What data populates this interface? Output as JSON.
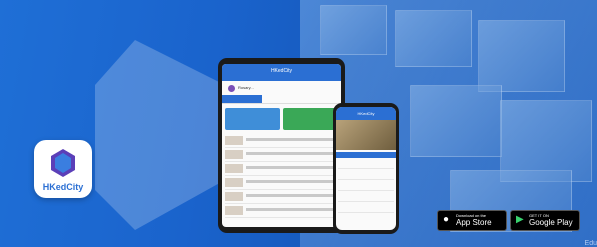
{
  "app": {
    "name": "HKedCity",
    "logo_text": "HKedCity"
  },
  "tablet": {
    "header_title": "HKedCity",
    "user_name": "Rosary...",
    "tabs": [
      "",
      "",
      ""
    ],
    "cards": [
      "",
      ""
    ]
  },
  "phone": {
    "header_title": "HKedCity"
  },
  "badges": {
    "app_store": {
      "small": "Download on the",
      "big": "App Store"
    },
    "google_play": {
      "small": "GET IT ON",
      "big": "Google Play"
    }
  },
  "watermark": "Edu"
}
